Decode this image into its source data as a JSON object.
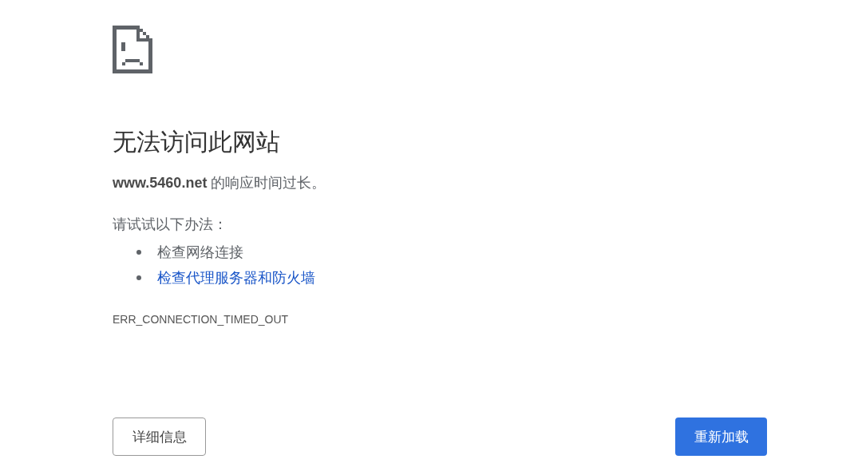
{
  "heading": "无法访问此网站",
  "message": "**www.5460.net** 的响应时间过长。",
  "suggestions_intro": "请试试以下办法：",
  "suggestions": [
    {
      "kind": "text",
      "label": "检查网络连接"
    },
    {
      "kind": "link",
      "label": "检查代理服务器和防火墙"
    }
  ],
  "error_code": "ERR_CONNECTION_TIMED_OUT",
  "buttons": [
    {
      "kind": "secondary",
      "label": "详细信息"
    },
    {
      "kind": "primary",
      "label": "重新加载"
    }
  ]
}
